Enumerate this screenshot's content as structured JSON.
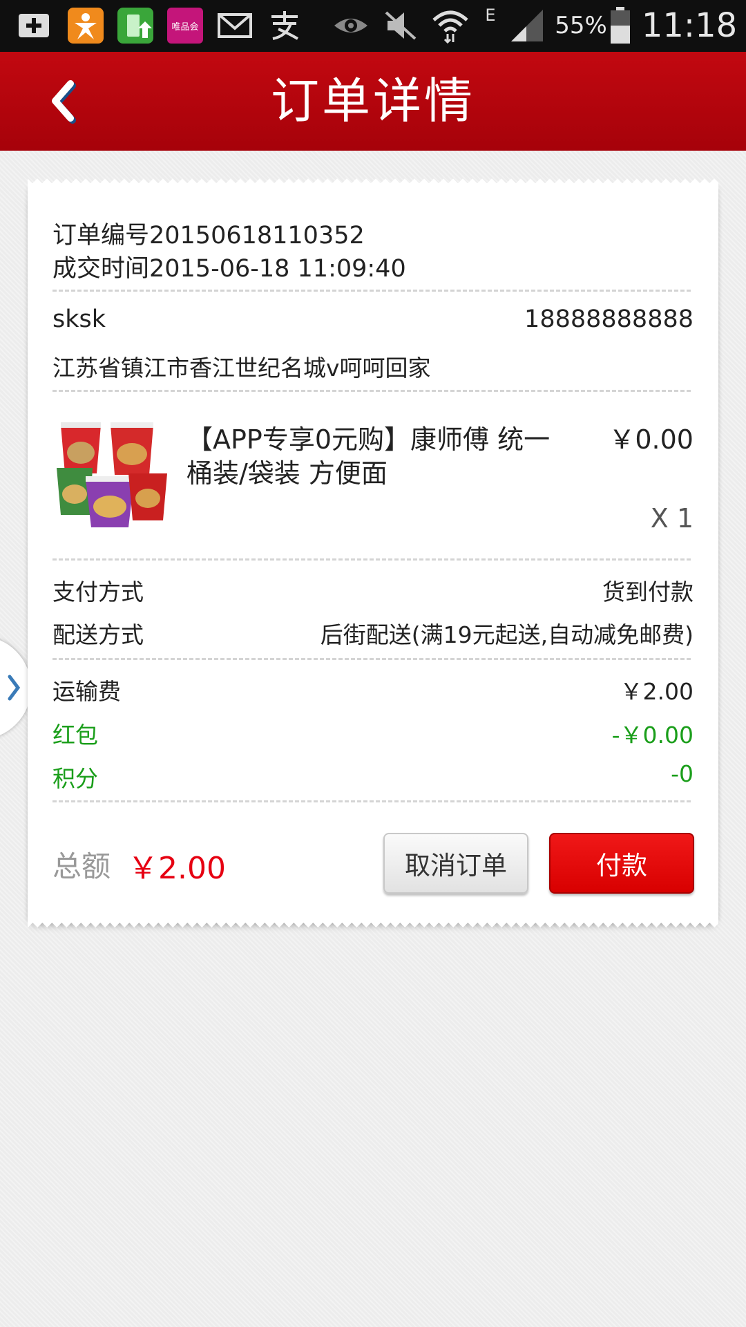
{
  "statusbar": {
    "battery": "55%",
    "time": "11:18",
    "network": "E",
    "vip_app_label": "唯品会",
    "icons": [
      "plus-icon",
      "app-orange-icon",
      "battery-charge-app-icon",
      "vip-app-icon",
      "mail-icon",
      "alipay-icon",
      "eye-icon",
      "mute-icon",
      "wifi-icon",
      "signal-icon",
      "battery-icon"
    ]
  },
  "appbar": {
    "title": "订单详情"
  },
  "order": {
    "number": "订单编号20150618110352",
    "time": "成交时间2015-06-18 11:09:40"
  },
  "contact": {
    "name": "sksk",
    "phone": "18888888888",
    "address": "江苏省镇江市香江世纪名城v呵呵回家"
  },
  "product": {
    "title_line1": "【APP专享0元购】康师傅 统一",
    "title_line2": "桶装/袋装 方便面",
    "price": "￥0.00",
    "quantity": "X 1"
  },
  "payment": {
    "pay_label": "支付方式",
    "pay_value": "货到付款",
    "delivery_label": "配送方式",
    "delivery_value": "后街配送(满19元起送,自动减免邮费)"
  },
  "fees": {
    "shipping_label": "运输费",
    "shipping_value": "￥2.00",
    "redpacket_label": "红包",
    "redpacket_value": "-￥0.00",
    "points_label": "积分",
    "points_value": "-0"
  },
  "footer": {
    "total_label": "总额",
    "total_value": "￥2.00",
    "cancel_button": "取消订单",
    "pay_button": "付款"
  },
  "colors": {
    "brand_red": "#b8050d",
    "price_red": "#e60012",
    "green": "#1a9e1a"
  }
}
